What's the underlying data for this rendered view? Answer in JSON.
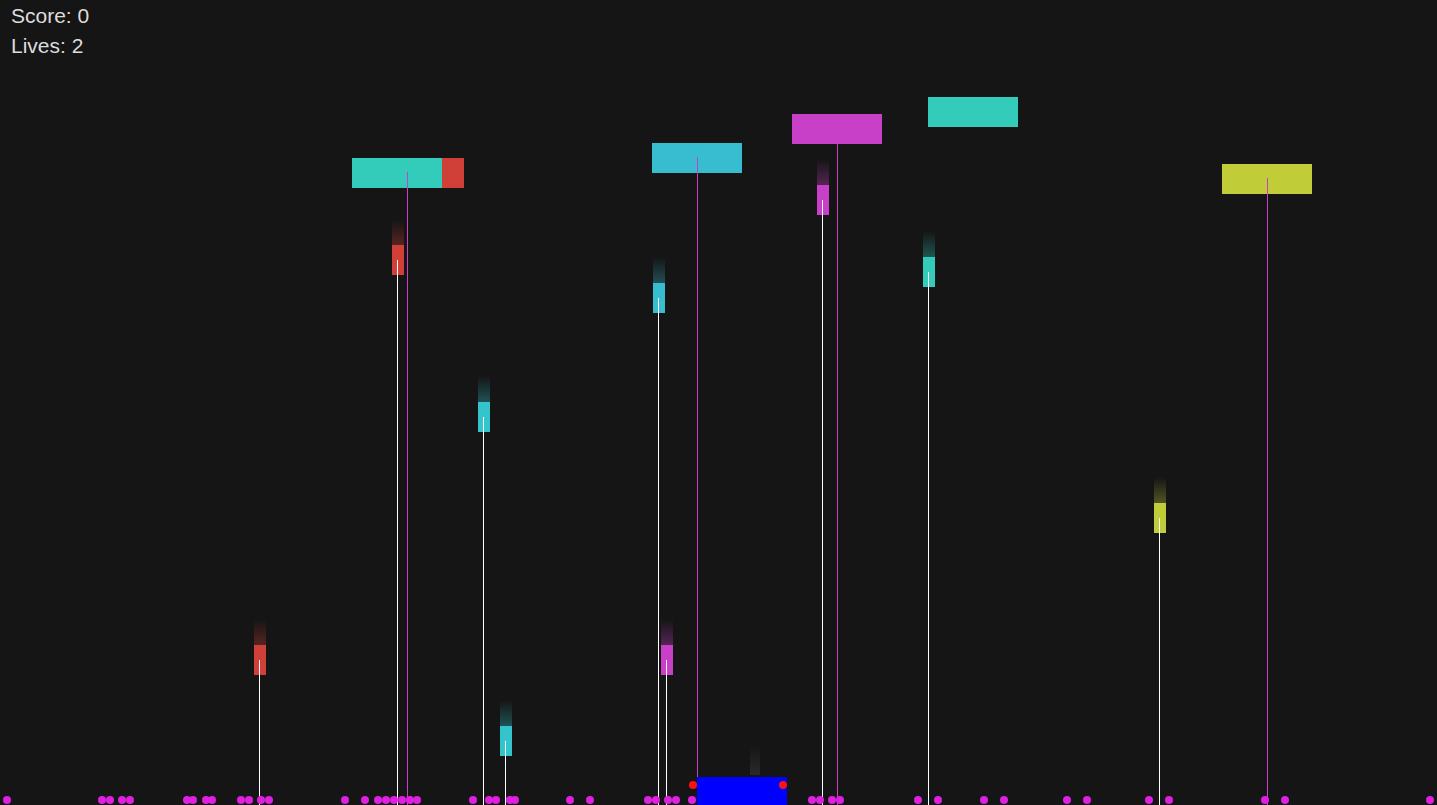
{
  "hud": {
    "score": "Score: 0",
    "lives": "Lives: 2"
  },
  "blocks": [
    {
      "color": "#d04038"
    },
    {
      "color": "#33ccbb"
    },
    {
      "color": "#38bcd0"
    },
    {
      "color": "#c840c8"
    },
    {
      "color": "#33ccbb"
    },
    {
      "color": "#c0cc38"
    }
  ],
  "projectiles": [
    {
      "color": "#d04038"
    },
    {
      "color": "#d04038"
    },
    {
      "color": "#33c4cc"
    },
    {
      "color": "#33c4cc"
    },
    {
      "color": "#38bcd0"
    },
    {
      "color": "#c840c8"
    },
    {
      "color": "#c840c8"
    },
    {
      "color": "#33ccbb"
    },
    {
      "color": "#c0cc38"
    }
  ]
}
